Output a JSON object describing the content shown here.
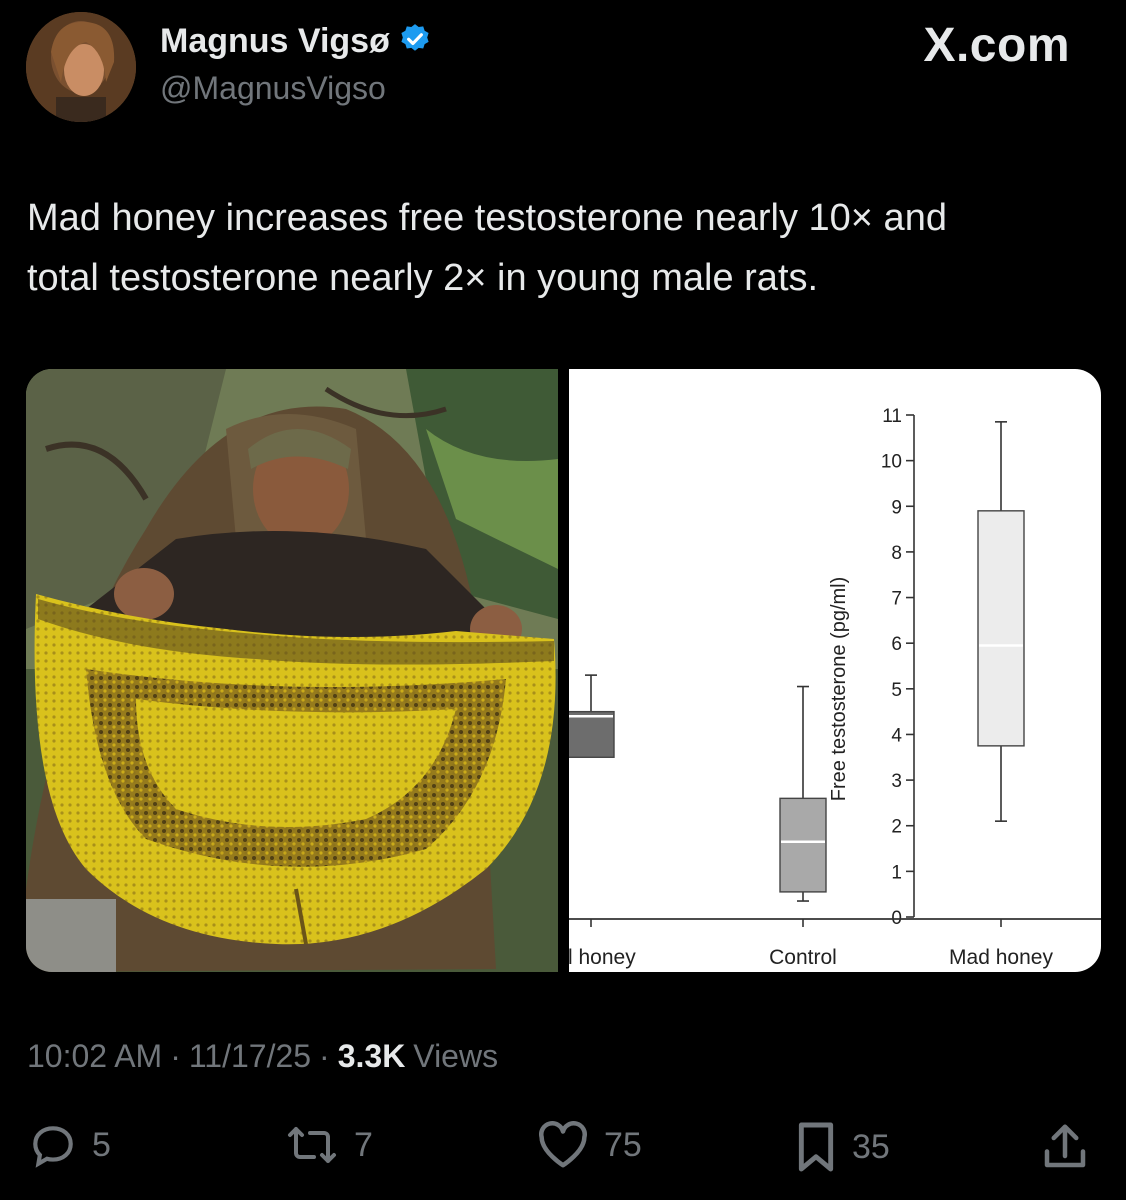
{
  "author": {
    "display_name": "Magnus Vigsø",
    "handle": "@MagnusVigso",
    "verified": true
  },
  "brand": "X.com",
  "tweet": {
    "text_line1": "Mad honey increases free testosterone nearly 10× and",
    "text_line2": "total testosterone nearly 2× in young male rats."
  },
  "meta": {
    "time": "10:02 AM",
    "date": "11/17/25",
    "views_count": "3.3K",
    "views_label": "Views",
    "separator": "·"
  },
  "actions": {
    "replies": "5",
    "reposts": "7",
    "likes": "75",
    "bookmarks": "35"
  },
  "colors": {
    "background": "#000000",
    "text": "#e7e9ea",
    "muted": "#71767b",
    "verified": "#1d9bf0",
    "honey_yellow": "#d8c21d"
  },
  "chart_data": {
    "type": "box",
    "ylabel": "Free testosterone (pg/ml)",
    "ylim": [
      0,
      11
    ],
    "yticks": [
      "0",
      "1",
      "2",
      "3",
      "4",
      "5",
      "6",
      "7",
      "8",
      "9",
      "10",
      "11"
    ],
    "categories": [
      "al honey",
      "Control",
      "Mad honey"
    ],
    "boxes": [
      {
        "name": "al honey",
        "min": null,
        "q1": 3.5,
        "median": 4.4,
        "q3": 4.5,
        "max": 5.3
      },
      {
        "name": "Control",
        "min": 0.35,
        "q1": 0.55,
        "median": 1.65,
        "q3": 2.6,
        "max": 5.05
      },
      {
        "name": "Mad honey",
        "min": 2.1,
        "q1": 3.75,
        "median": 5.95,
        "q3": 8.9,
        "max": 10.85
      }
    ],
    "grid": false
  }
}
